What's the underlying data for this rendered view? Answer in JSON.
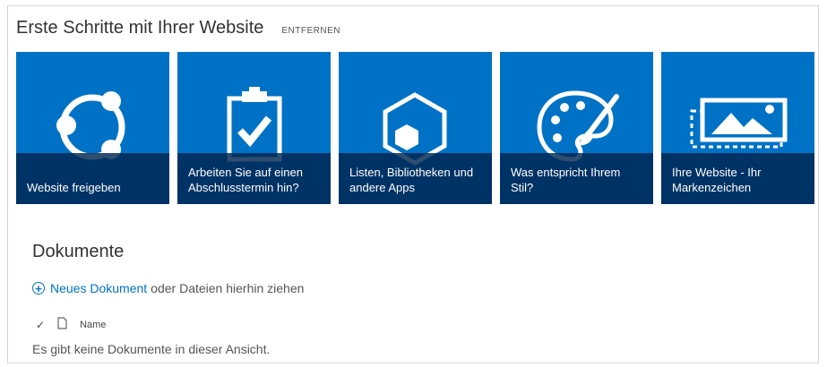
{
  "header": {
    "title": "Erste Schritte mit Ihrer Website",
    "remove_label": "ENTFERNEN"
  },
  "tiles": [
    {
      "label": "Website freigeben",
      "icon": "share-icon"
    },
    {
      "label": "Arbeiten Sie auf einen Abschlusstermin hin?",
      "icon": "clipboard-check-icon"
    },
    {
      "label": "Listen, Bibliotheken und andere Apps",
      "icon": "apps-hexagon-icon"
    },
    {
      "label": "Was entspricht Ihrem Stil?",
      "icon": "palette-brush-icon"
    },
    {
      "label": "Ihre Website - Ihr Markenzeichen",
      "icon": "image-logo-icon"
    }
  ],
  "documents": {
    "title": "Dokumente",
    "new_link": "Neues Dokument",
    "new_rest": "oder Dateien hierhin ziehen",
    "column_name": "Name",
    "empty_message": "Es gibt keine Dokumente in dieser Ansicht."
  },
  "colors": {
    "tile_blue": "#0072c6",
    "caption_bg": "#00264f",
    "link_blue": "#0072c6"
  }
}
